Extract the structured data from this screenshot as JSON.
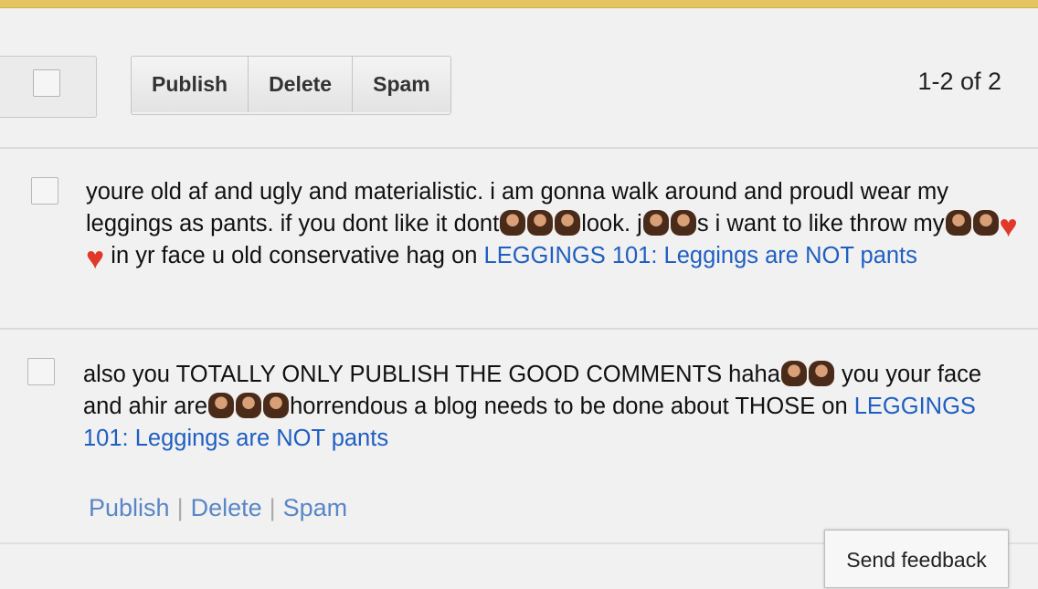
{
  "toolbar": {
    "publish_label": "Publish",
    "delete_label": "Delete",
    "spam_label": "Spam",
    "pager": "1-2 of 2"
  },
  "comments": [
    {
      "seg1": "youre old af and ugly and materialistic. i am gonna walk around and proudl wear my leggings as pants. if you dont like it dont",
      "seg2": "look. j",
      "seg3": "s i want to like throw my",
      "seg4": "in yr face u old conservative hag on ",
      "post_link": "LEGGINGS 101: Leggings are NOT pants"
    },
    {
      "seg1": "also you TOTALLY ONLY PUBLISH THE GOOD COMMENTS haha",
      "seg2": " you your face and ahir are",
      "seg3": "horrendous a blog needs to be done about THOSE on ",
      "post_link": "LEGGINGS 101: Leggings are NOT pants"
    }
  ],
  "row_actions": {
    "publish": "Publish",
    "delete": "Delete",
    "spam": "Spam"
  },
  "feedback_label": "Send feedback",
  "colors": {
    "top_accent": "#e4c560",
    "link": "#1f5fc2",
    "heart": "#e0392a"
  }
}
